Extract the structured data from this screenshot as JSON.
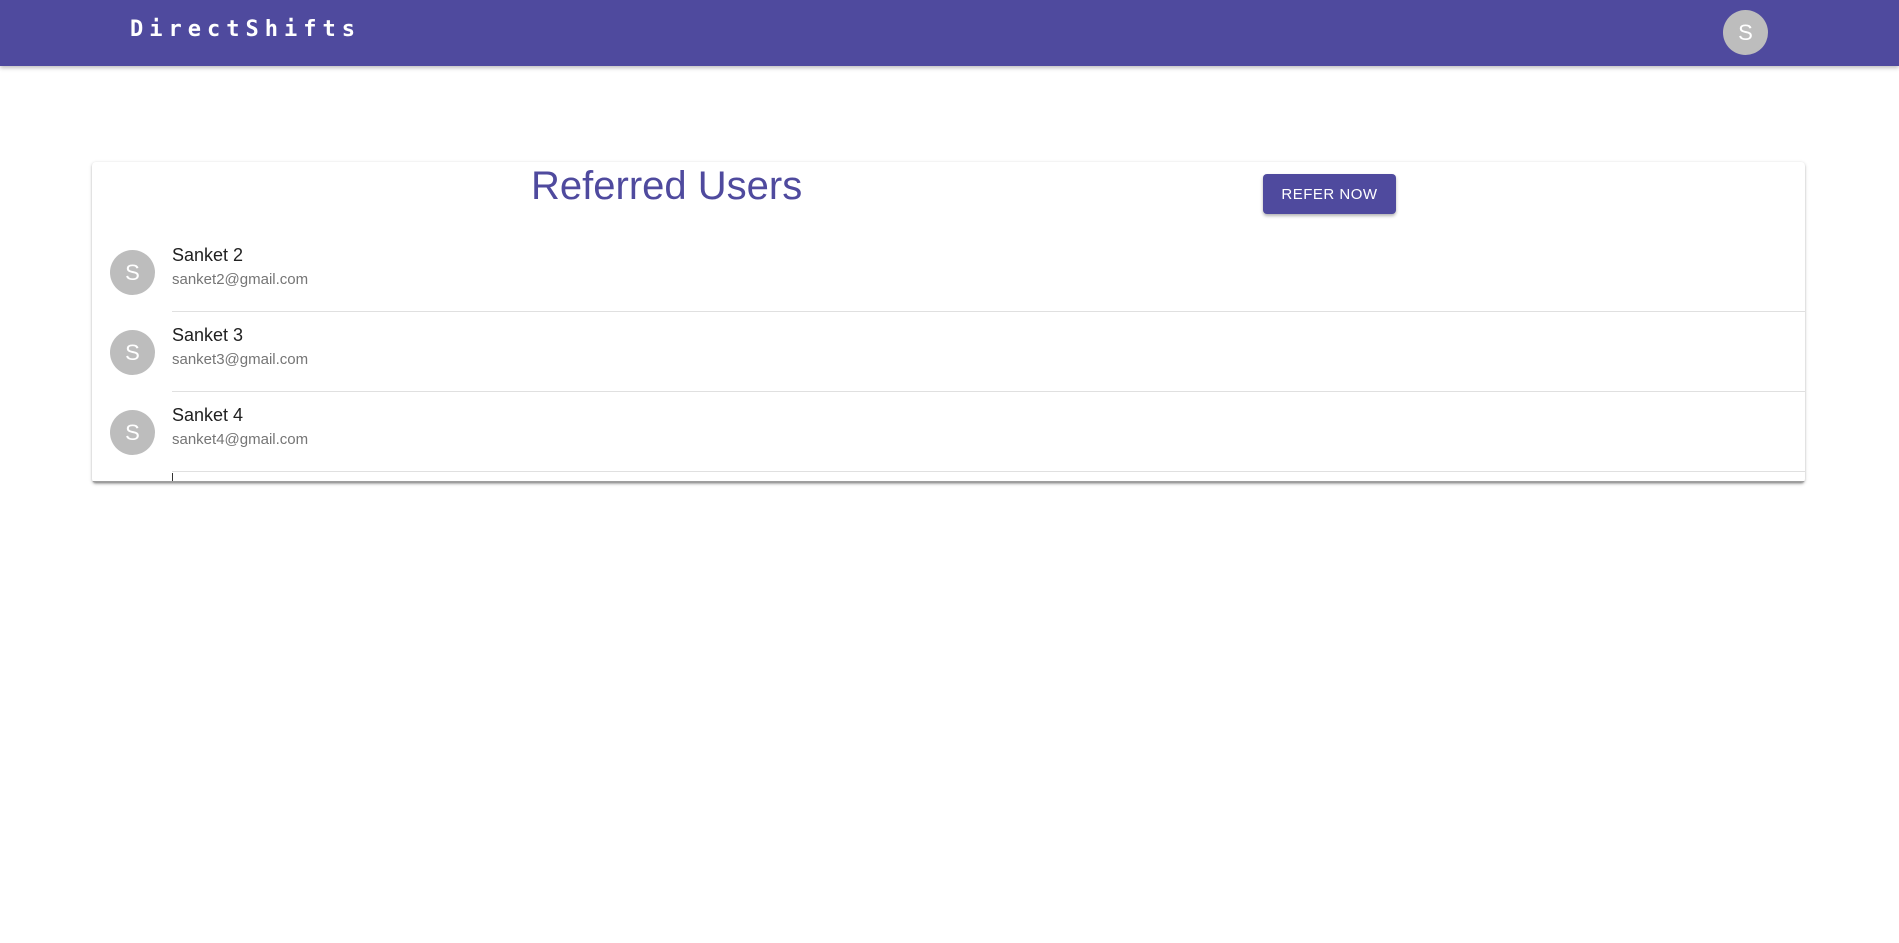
{
  "app_bar": {
    "brand": "DirectShifts",
    "avatar_letter": "S"
  },
  "card": {
    "title": "Referred Users",
    "refer_button_label": "Refer Now"
  },
  "users": [
    {
      "avatar_letter": "S",
      "name": "Sanket 2",
      "email": "sanket2@gmail.com"
    },
    {
      "avatar_letter": "S",
      "name": "Sanket 3",
      "email": "sanket3@gmail.com"
    },
    {
      "avatar_letter": "S",
      "name": "Sanket 4",
      "email": "sanket4@gmail.com"
    }
  ],
  "colors": {
    "primary": "#4f4a9e",
    "avatar_bg": "#bdbdbd",
    "text_primary": "#212121",
    "text_secondary": "#757575"
  }
}
